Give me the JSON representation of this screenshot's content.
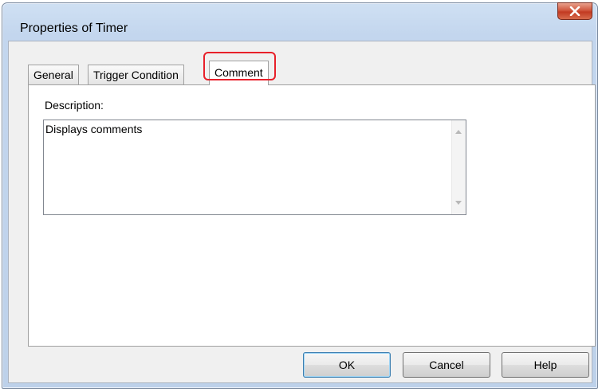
{
  "window": {
    "title": "Properties of Timer",
    "close_icon": "close-icon"
  },
  "tabs": [
    {
      "label": "General"
    },
    {
      "label": "Trigger Condition"
    },
    {
      "label": "Comment",
      "active": true
    }
  ],
  "comment_tab": {
    "description_label": "Description:",
    "description_value": "Displays comments"
  },
  "buttons": {
    "ok": "OK",
    "cancel": "Cancel",
    "help": "Help"
  },
  "colors": {
    "highlight": "#e8202a",
    "close_button": "#c23a22"
  }
}
